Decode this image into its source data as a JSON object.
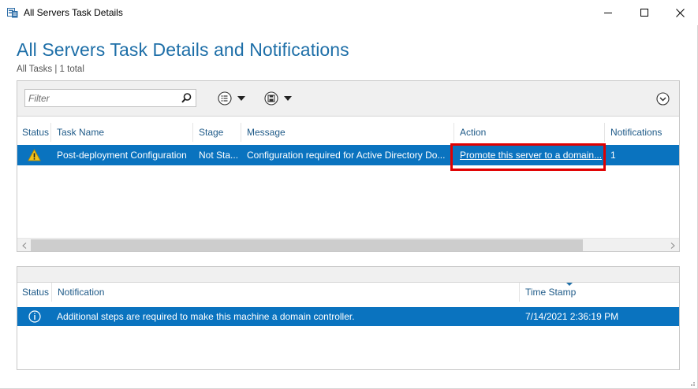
{
  "window": {
    "title": "All Servers Task Details",
    "minimize_glyph": "—",
    "maximize_glyph": "☐",
    "close_glyph": "✕"
  },
  "header": {
    "title": "All Servers Task Details and Notifications",
    "subtitle": "All Tasks | 1 total"
  },
  "toolbar": {
    "filter_placeholder": "Filter",
    "icons": [
      "search-icon",
      "list-options-icon",
      "save-query-icon",
      "expand-collapse-icon"
    ]
  },
  "tasks_table": {
    "columns": [
      "Status",
      "Task Name",
      "Stage",
      "Message",
      "Action",
      "Notifications"
    ],
    "rows": [
      {
        "status_icon": "warning-icon",
        "task_name": "Post-deployment Configuration",
        "stage": "Not Sta...",
        "message": "Configuration required for Active Directory Do...",
        "action": "Promote this server to a domain...",
        "notifications": "1"
      }
    ]
  },
  "notifications_table": {
    "columns": [
      "Status",
      "Notification",
      "Time Stamp"
    ],
    "sorted_column": "Time Stamp",
    "rows": [
      {
        "status_icon": "info-icon",
        "notification": "Additional steps are required to make this machine a domain controller.",
        "timestamp": "7/14/2021 2:36:19 PM"
      }
    ]
  },
  "colors": {
    "title_blue": "#1e6fa8",
    "selection_blue": "#0a73bf",
    "highlight_red": "#e00000",
    "warning_yellow": "#f2c21b"
  }
}
